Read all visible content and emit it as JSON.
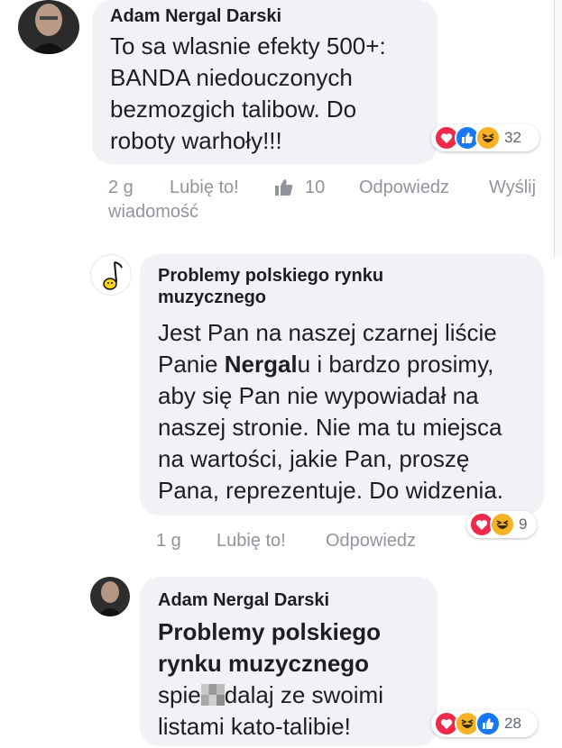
{
  "comments": [
    {
      "author": "Adam Nergal Darski",
      "text_lines": [
        "To sa wlasnie efekty 500+:",
        "BANDA niedouczonych",
        "bezmozgich talibow. Do",
        "roboty warhoły!!!"
      ],
      "reactions": [
        "love",
        "like",
        "haha"
      ],
      "reaction_count": "32",
      "time": "2 g",
      "like_label": "Lubię to!",
      "like_icon": "thumbs-up-icon",
      "like_count": "10",
      "reply_label": "Odpowiedz",
      "message_label_1": "Wyślij",
      "message_label_2": "wiadomość"
    },
    {
      "author_line_1": "Problemy polskiego rynku",
      "author_line_2": "muzycznego",
      "text_line_1": "Jest Pan na naszej czarnej liście",
      "text_line_2_a": "Panie ",
      "text_line_2_bold": "Nergal",
      "text_line_2_b": "u i bardzo prosimy,",
      "text_line_3": "aby się Pan nie wypowiadał na",
      "text_line_4": "naszej stronie. Nie ma tu miejsca",
      "text_line_5": "na wartości, jakie Pan, proszę",
      "text_line_6": "Pana, reprezentuje. Do widzenia.",
      "reactions": [
        "love",
        "haha"
      ],
      "reaction_count": "9",
      "time": "1 g",
      "like_label": "Lubię to!",
      "reply_label": "Odpowiedz"
    },
    {
      "author": "Adam Nergal Darski",
      "mention_line_1": "Problemy polskiego",
      "mention_line_2": "rynku muzycznego",
      "text_line_1_a": "spie",
      "text_line_1_b": "dalaj ze swoimi",
      "text_line_2": "listami kato-talibie!",
      "reactions": [
        "love",
        "haha",
        "like"
      ],
      "reaction_count": "28"
    }
  ],
  "colors": {
    "bubble": "#f0f2f5",
    "meta_text": "#90949c",
    "love": "#f0284a",
    "like": "#1877f2",
    "haha": "#f7b125"
  }
}
